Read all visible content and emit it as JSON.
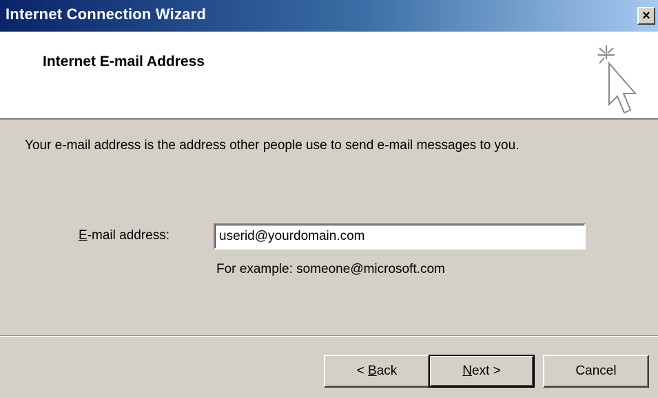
{
  "window": {
    "title": "Internet Connection Wizard",
    "close_symbol": "×"
  },
  "header": {
    "title": "Internet E-mail Address",
    "icon": "wizard-cursor-sparkle-icon"
  },
  "main": {
    "description": "Your e-mail address is the address other people use to send e-mail messages to you.",
    "email_label_hotkey": "E",
    "email_label_rest": "-mail address:",
    "email_value": "userid@yourdomain.com",
    "example": "For example: someone@microsoft.com"
  },
  "buttons": {
    "back_prefix": "< ",
    "back_hotkey": "B",
    "back_rest": "ack",
    "next_hotkey": "N",
    "next_rest": "ext >",
    "cancel": "Cancel"
  },
  "colors": {
    "title_gradient_start": "#0a246a",
    "title_gradient_end": "#a6caf0",
    "dialog_face": "#d4d0c8",
    "header_background": "#ffffff"
  }
}
